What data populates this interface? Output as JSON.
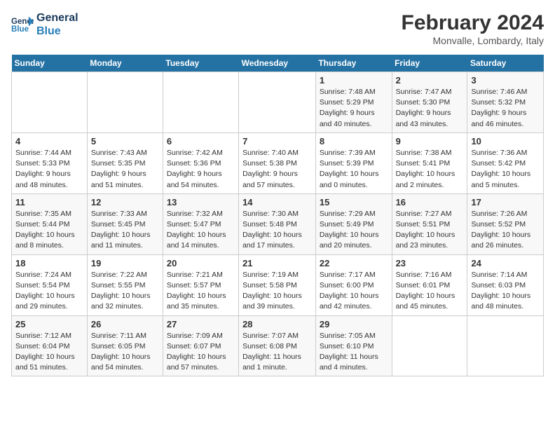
{
  "header": {
    "logo_line1": "General",
    "logo_line2": "Blue",
    "title": "February 2024",
    "subtitle": "Monvalle, Lombardy, Italy"
  },
  "weekdays": [
    "Sunday",
    "Monday",
    "Tuesday",
    "Wednesday",
    "Thursday",
    "Friday",
    "Saturday"
  ],
  "weeks": [
    [
      {
        "day": "",
        "info": ""
      },
      {
        "day": "",
        "info": ""
      },
      {
        "day": "",
        "info": ""
      },
      {
        "day": "",
        "info": ""
      },
      {
        "day": "1",
        "info": "Sunrise: 7:48 AM\nSunset: 5:29 PM\nDaylight: 9 hours\nand 40 minutes."
      },
      {
        "day": "2",
        "info": "Sunrise: 7:47 AM\nSunset: 5:30 PM\nDaylight: 9 hours\nand 43 minutes."
      },
      {
        "day": "3",
        "info": "Sunrise: 7:46 AM\nSunset: 5:32 PM\nDaylight: 9 hours\nand 46 minutes."
      }
    ],
    [
      {
        "day": "4",
        "info": "Sunrise: 7:44 AM\nSunset: 5:33 PM\nDaylight: 9 hours\nand 48 minutes."
      },
      {
        "day": "5",
        "info": "Sunrise: 7:43 AM\nSunset: 5:35 PM\nDaylight: 9 hours\nand 51 minutes."
      },
      {
        "day": "6",
        "info": "Sunrise: 7:42 AM\nSunset: 5:36 PM\nDaylight: 9 hours\nand 54 minutes."
      },
      {
        "day": "7",
        "info": "Sunrise: 7:40 AM\nSunset: 5:38 PM\nDaylight: 9 hours\nand 57 minutes."
      },
      {
        "day": "8",
        "info": "Sunrise: 7:39 AM\nSunset: 5:39 PM\nDaylight: 10 hours\nand 0 minutes."
      },
      {
        "day": "9",
        "info": "Sunrise: 7:38 AM\nSunset: 5:41 PM\nDaylight: 10 hours\nand 2 minutes."
      },
      {
        "day": "10",
        "info": "Sunrise: 7:36 AM\nSunset: 5:42 PM\nDaylight: 10 hours\nand 5 minutes."
      }
    ],
    [
      {
        "day": "11",
        "info": "Sunrise: 7:35 AM\nSunset: 5:44 PM\nDaylight: 10 hours\nand 8 minutes."
      },
      {
        "day": "12",
        "info": "Sunrise: 7:33 AM\nSunset: 5:45 PM\nDaylight: 10 hours\nand 11 minutes."
      },
      {
        "day": "13",
        "info": "Sunrise: 7:32 AM\nSunset: 5:47 PM\nDaylight: 10 hours\nand 14 minutes."
      },
      {
        "day": "14",
        "info": "Sunrise: 7:30 AM\nSunset: 5:48 PM\nDaylight: 10 hours\nand 17 minutes."
      },
      {
        "day": "15",
        "info": "Sunrise: 7:29 AM\nSunset: 5:49 PM\nDaylight: 10 hours\nand 20 minutes."
      },
      {
        "day": "16",
        "info": "Sunrise: 7:27 AM\nSunset: 5:51 PM\nDaylight: 10 hours\nand 23 minutes."
      },
      {
        "day": "17",
        "info": "Sunrise: 7:26 AM\nSunset: 5:52 PM\nDaylight: 10 hours\nand 26 minutes."
      }
    ],
    [
      {
        "day": "18",
        "info": "Sunrise: 7:24 AM\nSunset: 5:54 PM\nDaylight: 10 hours\nand 29 minutes."
      },
      {
        "day": "19",
        "info": "Sunrise: 7:22 AM\nSunset: 5:55 PM\nDaylight: 10 hours\nand 32 minutes."
      },
      {
        "day": "20",
        "info": "Sunrise: 7:21 AM\nSunset: 5:57 PM\nDaylight: 10 hours\nand 35 minutes."
      },
      {
        "day": "21",
        "info": "Sunrise: 7:19 AM\nSunset: 5:58 PM\nDaylight: 10 hours\nand 39 minutes."
      },
      {
        "day": "22",
        "info": "Sunrise: 7:17 AM\nSunset: 6:00 PM\nDaylight: 10 hours\nand 42 minutes."
      },
      {
        "day": "23",
        "info": "Sunrise: 7:16 AM\nSunset: 6:01 PM\nDaylight: 10 hours\nand 45 minutes."
      },
      {
        "day": "24",
        "info": "Sunrise: 7:14 AM\nSunset: 6:03 PM\nDaylight: 10 hours\nand 48 minutes."
      }
    ],
    [
      {
        "day": "25",
        "info": "Sunrise: 7:12 AM\nSunset: 6:04 PM\nDaylight: 10 hours\nand 51 minutes."
      },
      {
        "day": "26",
        "info": "Sunrise: 7:11 AM\nSunset: 6:05 PM\nDaylight: 10 hours\nand 54 minutes."
      },
      {
        "day": "27",
        "info": "Sunrise: 7:09 AM\nSunset: 6:07 PM\nDaylight: 10 hours\nand 57 minutes."
      },
      {
        "day": "28",
        "info": "Sunrise: 7:07 AM\nSunset: 6:08 PM\nDaylight: 11 hours\nand 1 minute."
      },
      {
        "day": "29",
        "info": "Sunrise: 7:05 AM\nSunset: 6:10 PM\nDaylight: 11 hours\nand 4 minutes."
      },
      {
        "day": "",
        "info": ""
      },
      {
        "day": "",
        "info": ""
      }
    ]
  ]
}
